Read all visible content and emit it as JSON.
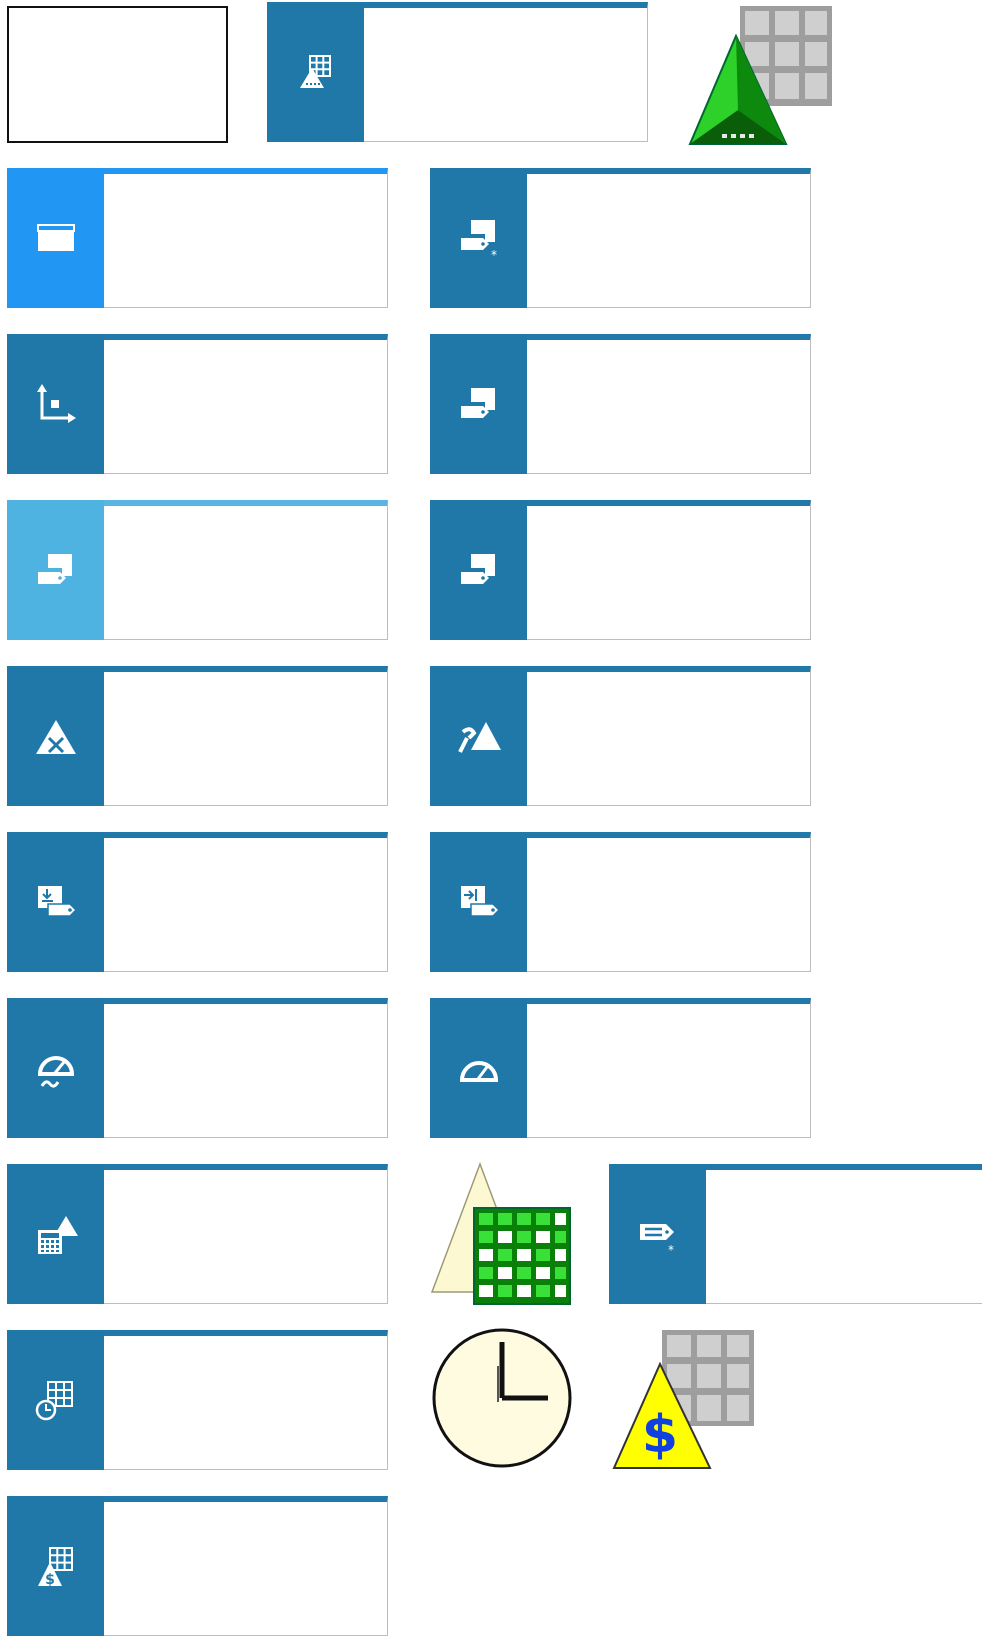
{
  "tiles": [
    {
      "name": "tile-grid-user",
      "icon": "grid-user-icon"
    },
    {
      "name": "tile-window",
      "icon": "window-icon"
    },
    {
      "name": "tile-tag-new",
      "icon": "tag-new-icon"
    },
    {
      "name": "tile-axes",
      "icon": "axes-icon"
    },
    {
      "name": "tile-tag",
      "icon": "tag-icon"
    },
    {
      "name": "tile-tag-light",
      "icon": "tag-icon"
    },
    {
      "name": "tile-tag-2",
      "icon": "tag-icon"
    },
    {
      "name": "tile-user-remove",
      "icon": "user-remove-icon"
    },
    {
      "name": "tile-user-link",
      "icon": "user-link-icon"
    },
    {
      "name": "tile-tag-import",
      "icon": "tag-import-icon"
    },
    {
      "name": "tile-tag-export",
      "icon": "tag-export-icon"
    },
    {
      "name": "tile-gauge-wave",
      "icon": "gauge-wave-icon"
    },
    {
      "name": "tile-gauge",
      "icon": "gauge-icon"
    },
    {
      "name": "tile-calculator-user",
      "icon": "calculator-user-icon"
    },
    {
      "name": "tile-label-new",
      "icon": "label-new-icon"
    },
    {
      "name": "tile-grid-clock",
      "icon": "grid-clock-icon"
    },
    {
      "name": "tile-grid-dollar",
      "icon": "grid-dollar-icon"
    }
  ],
  "standalone_icons": [
    {
      "name": "green-triangle-grid-icon"
    },
    {
      "name": "triangle-green-grid-icon"
    },
    {
      "name": "clock-icon"
    },
    {
      "name": "dollar-triangle-grid-icon"
    }
  ],
  "colors": {
    "tile_accent": "#1f78a7",
    "tile_accent_bright": "#2196f3",
    "tile_accent_light": "#4fb3e2",
    "tile_border": "#bdbdbd"
  }
}
